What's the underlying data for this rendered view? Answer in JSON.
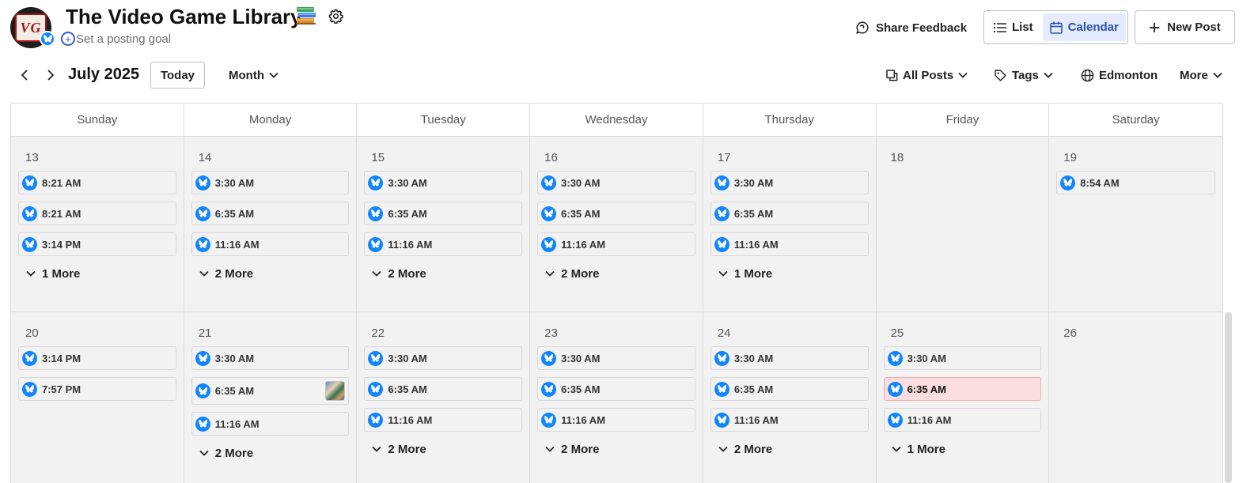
{
  "header": {
    "title": "The Video Game Library",
    "avatar_text": "VG",
    "posting_goal": "Set a posting goal",
    "share_feedback": "Share Feedback",
    "view_list": "List",
    "view_calendar": "Calendar",
    "new_post": "New Post",
    "icons": [
      "books-emoji-icon",
      "gear-icon",
      "bluesky-icon",
      "plus-icon",
      "feedback-icon",
      "list-icon",
      "calendar-icon",
      "plus-icon"
    ]
  },
  "toolbar": {
    "month": "July 2025",
    "today": "Today",
    "view_mode": "Month",
    "all_posts": "All Posts",
    "tags": "Tags",
    "timezone": "Edmonton",
    "more": "More"
  },
  "calendar": {
    "day_names": [
      "Sunday",
      "Monday",
      "Tuesday",
      "Wednesday",
      "Thursday",
      "Friday",
      "Saturday"
    ],
    "weeks": [
      {
        "days": [
          {
            "date": "13",
            "posts": [
              {
                "time": "8:21 AM"
              },
              {
                "time": "8:21 AM"
              },
              {
                "time": "3:14 PM"
              }
            ],
            "more": "1 More"
          },
          {
            "date": "14",
            "posts": [
              {
                "time": "3:30 AM"
              },
              {
                "time": "6:35 AM"
              },
              {
                "time": "11:16 AM"
              }
            ],
            "more": "2 More"
          },
          {
            "date": "15",
            "posts": [
              {
                "time": "3:30 AM"
              },
              {
                "time": "6:35 AM"
              },
              {
                "time": "11:16 AM"
              }
            ],
            "more": "2 More"
          },
          {
            "date": "16",
            "posts": [
              {
                "time": "3:30 AM"
              },
              {
                "time": "6:35 AM"
              },
              {
                "time": "11:16 AM"
              }
            ],
            "more": "2 More"
          },
          {
            "date": "17",
            "posts": [
              {
                "time": "3:30 AM"
              },
              {
                "time": "6:35 AM"
              },
              {
                "time": "11:16 AM"
              }
            ],
            "more": "1 More"
          },
          {
            "date": "18",
            "posts": [],
            "more": ""
          },
          {
            "date": "19",
            "posts": [
              {
                "time": "8:54 AM"
              }
            ],
            "more": ""
          }
        ]
      },
      {
        "days": [
          {
            "date": "20",
            "posts": [
              {
                "time": "3:14 PM"
              },
              {
                "time": "7:57 PM"
              }
            ],
            "more": ""
          },
          {
            "date": "21",
            "posts": [
              {
                "time": "3:30 AM"
              },
              {
                "time": "6:35 AM",
                "thumbnail": true
              },
              {
                "time": "11:16 AM"
              }
            ],
            "more": "2 More"
          },
          {
            "date": "22",
            "posts": [
              {
                "time": "3:30 AM"
              },
              {
                "time": "6:35 AM"
              },
              {
                "time": "11:16 AM"
              }
            ],
            "more": "2 More"
          },
          {
            "date": "23",
            "posts": [
              {
                "time": "3:30 AM"
              },
              {
                "time": "6:35 AM"
              },
              {
                "time": "11:16 AM"
              }
            ],
            "more": "2 More"
          },
          {
            "date": "24",
            "posts": [
              {
                "time": "3:30 AM"
              },
              {
                "time": "6:35 AM"
              },
              {
                "time": "11:16 AM"
              }
            ],
            "more": "2 More"
          },
          {
            "date": "25",
            "posts": [
              {
                "time": "3:30 AM"
              },
              {
                "time": "6:35 AM",
                "highlight": true
              },
              {
                "time": "11:16 AM"
              }
            ],
            "more": "1 More"
          },
          {
            "date": "26",
            "posts": [],
            "more": ""
          }
        ]
      }
    ]
  },
  "colors": {
    "bluesky": "#1185fe",
    "active_view_bg": "#e3ebfc",
    "active_view_text": "#2a4fb0",
    "highlight_post_bg": "#fbdfe0",
    "cell_bg": "#f2f2f2"
  }
}
